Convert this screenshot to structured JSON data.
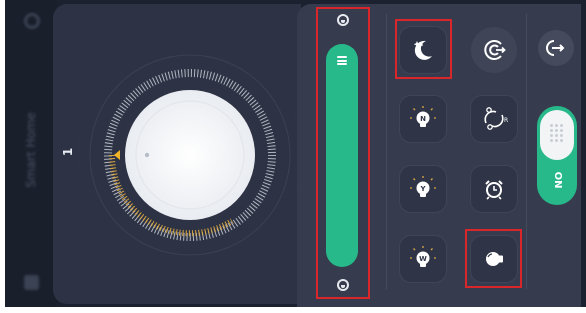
{
  "sidebar": {
    "title": "Smart Home",
    "icons": [
      "gear-icon",
      "grid-icon"
    ]
  },
  "dial": {
    "value_label": "1",
    "colors": {
      "ring": "#f0f2f5",
      "ticks": "#d9a640",
      "pointer": "#f0b429"
    }
  },
  "brightness": {
    "level": 1.0,
    "icons": [
      "brightness-high-icon",
      "brightness-low-icon"
    ],
    "color": "#27b98a"
  },
  "buttons": [
    {
      "name": "night-mode-button",
      "icon": "moon-stars-icon"
    },
    {
      "name": "reading-mode-button",
      "icon": "eye-icon"
    },
    {
      "name": "n-mode-bulb-button",
      "icon": "bulb-n-icon"
    },
    {
      "name": "rotate-mode-button",
      "icon": "rotate-arrows-icon"
    },
    {
      "name": "y-mode-bulb-button",
      "icon": "bulb-y-icon"
    },
    {
      "name": "timer-button",
      "icon": "alarm-clock-icon"
    },
    {
      "name": "w-mode-bulb-button",
      "icon": "bulb-w-icon"
    },
    {
      "name": "bulb-button",
      "icon": "bulb-icon"
    }
  ],
  "side": {
    "back_icon": "exit-arrow-icon",
    "toggle_label": "ON",
    "toggle_on": true,
    "accent": "#27b98a"
  }
}
